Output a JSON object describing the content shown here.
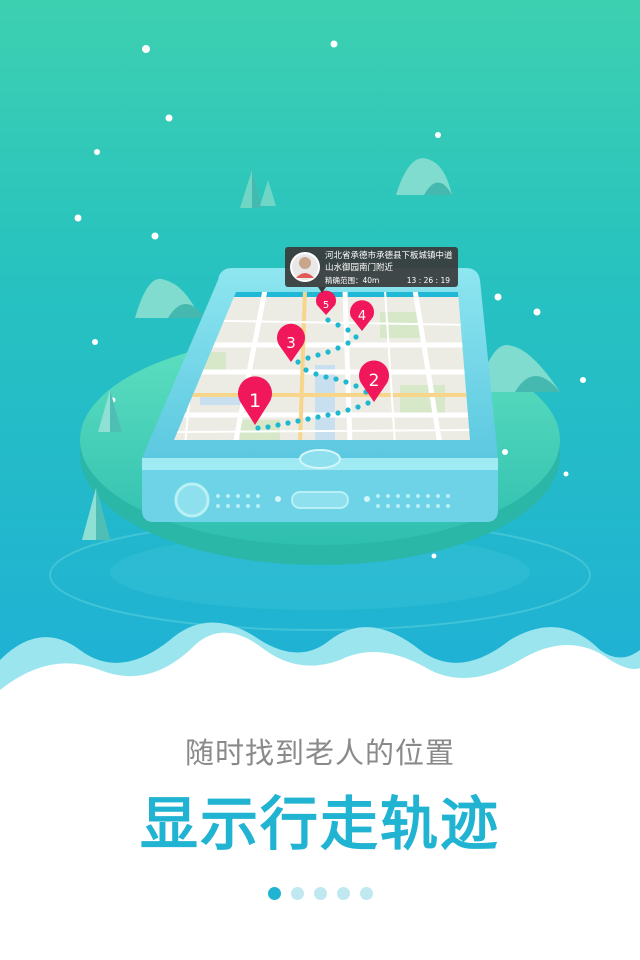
{
  "popup": {
    "address_line1": "河北省承德市承德县下板城镇中道",
    "address_line2": "山水御园南门附近",
    "accuracy": "精确范围：40m",
    "time": "13 : 26 : 19"
  },
  "markers": [
    "1",
    "2",
    "3",
    "4",
    "5"
  ],
  "caption": {
    "subtitle": "随时找到老人的位置",
    "title": "显示行走轨迹"
  },
  "pagination": {
    "total": 5,
    "active_index": 0
  },
  "colors": {
    "accent": "#21b3d2",
    "marker": "#f0185a",
    "route": "#1fb8d0",
    "subtitle": "#8a8a8a"
  }
}
